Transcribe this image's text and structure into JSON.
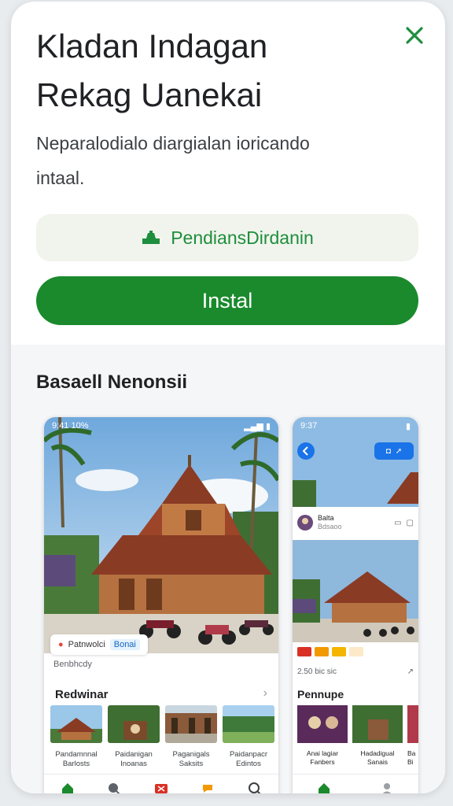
{
  "header": {
    "title_line1": "Kladan Indagan",
    "title_line2": "Rekag Uanekai",
    "desc_line1": "Neparalodialo diargialan ioricando",
    "desc_line2": "intaal.",
    "ad_label": "PendiansDirdanin",
    "install_label": "Instal"
  },
  "section": {
    "title": "Basaell Nenonsii"
  },
  "phone1": {
    "status_time": "9:41 10%",
    "chip_label": "Patnwolci",
    "chip_tag": "Bonai",
    "by_label": "Benbhcdy",
    "card_title": "Redwinar",
    "thumbs": [
      {
        "line1": "Pandamnnal",
        "line2": "Barlosts"
      },
      {
        "line1": "Paidanigan",
        "line2": "Inoanas"
      },
      {
        "line1": "Paganigals",
        "line2": "Saksits"
      },
      {
        "line1": "Paidanpacr",
        "line2": "Edintos"
      }
    ]
  },
  "phone2": {
    "status_time": "9:37",
    "post_name": "Balta",
    "post_sub": "Bdsaoo",
    "meta_text": "2.50 bic sic",
    "card_title": "Pennupe",
    "thumbs": [
      {
        "line1": "Anai lagiar",
        "line2": "Fanbers"
      },
      {
        "line1": "Hadadigual",
        "line2": "Sanais"
      },
      {
        "line1": "Ba",
        "line2": "Bi"
      }
    ]
  },
  "colors": {
    "accent": "#1a8a2c",
    "close": "#1e8e3e",
    "ad_bg": "#f1f4ec"
  }
}
